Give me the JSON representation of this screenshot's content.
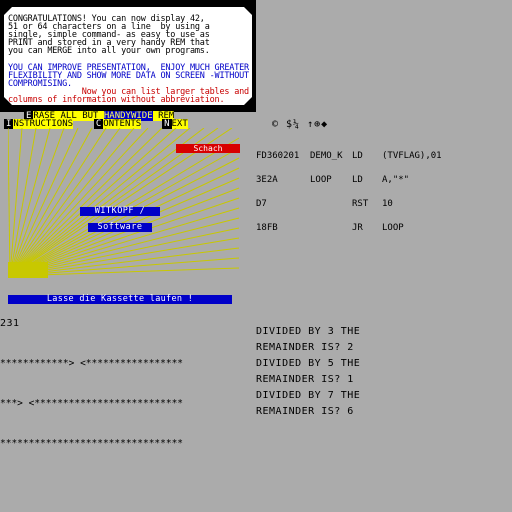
{
  "card": {
    "block_a": "CONGRATULATIONS! You can now display 42,\n51 or 64 characters on a line  by using a\nsingle, simple command- as easy to use as\nPRINT and stored in a very handy REM that\nyou can MERGE into all your own programs.",
    "block_b": "YOU CAN IMPROVE PRESENTATION,  ENJOY MUCH GREATER\nFLEXIBILITY AND SHOW MORE DATA ON SCREEN -WITHOUT\nCOMPROMISING.",
    "block_c": "Now you can list larger tables and\ncolumns of information without abbreviation."
  },
  "menu": {
    "row1": {
      "key": "E",
      "label": "RASE ALL BUT",
      "highlight": "HANDYWIDE",
      "tail": "REM"
    },
    "row2": [
      {
        "key": "I",
        "label": "NSTRUCTIONS"
      },
      {
        "key": "C",
        "label": "ONTENTS"
      },
      {
        "key": "N",
        "label": "EXT"
      }
    ],
    "icons": "© $¼ ↑⊕◆"
  },
  "graphic": {
    "schach": "Schach",
    "logo_line1": "WITKOPF /",
    "logo_line2": "Software",
    "tape_prompt": "Lasse die Kassette laufen !",
    "ray_color": "#c8c800"
  },
  "code": {
    "col1": [
      "FD360201",
      "3E2A",
      "D7",
      "18FB"
    ],
    "col2": [
      "DEMO_K",
      "LOOP",
      "",
      ""
    ],
    "col3": [
      "LD",
      "LD",
      "RST",
      "JR"
    ],
    "col4": [
      "(TVFLAG),01",
      "A,\"*\"",
      "10",
      "LOOP"
    ]
  },
  "console": {
    "number": "231",
    "left_lines": [
      "************> <*****************",
      "***> <**************************",
      "********************************"
    ],
    "right_lines": [
      "DIVIDED BY 3 THE",
      "REMAINDER IS? 2",
      "DIVIDED BY 5 THE",
      "REMAINDER IS? 1",
      "DIVIDED BY 7 THE",
      "REMAINDER IS? 6"
    ]
  }
}
